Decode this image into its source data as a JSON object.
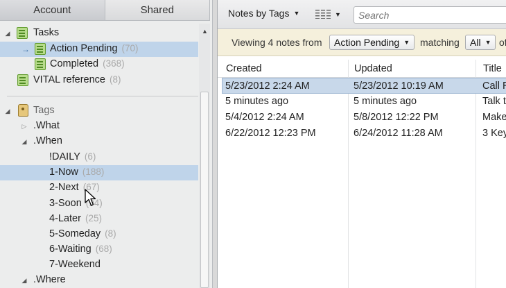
{
  "sidebar": {
    "tabs": [
      {
        "label": "Account"
      },
      {
        "label": "Shared"
      }
    ],
    "notebooks": {
      "group_label": "Tasks",
      "items": [
        {
          "label": "Action Pending",
          "count": "(70)"
        },
        {
          "label": "Completed",
          "count": "(368)"
        }
      ],
      "other": {
        "label": "VITAL reference",
        "count": "(8)"
      }
    },
    "tags": {
      "group_label": "Tags",
      "what": ".What",
      "when": ".When",
      "when_items": [
        {
          "label": "!DAILY",
          "count": "(6)"
        },
        {
          "label": "1-Now",
          "count": "(188)"
        },
        {
          "label": "2-Next",
          "count": "(67)"
        },
        {
          "label": "3-Soon",
          "count": "(94)"
        },
        {
          "label": "4-Later",
          "count": "(25)"
        },
        {
          "label": "5-Someday",
          "count": "(8)"
        },
        {
          "label": "6-Waiting",
          "count": "(68)"
        },
        {
          "label": "7-Weekend",
          "count": ""
        }
      ],
      "where": ".Where"
    }
  },
  "toolbar": {
    "view_label": "Notes by Tags",
    "search_placeholder": "Search"
  },
  "filter": {
    "prefix": "Viewing 4 notes from",
    "notebook": "Action Pending",
    "matching": "matching",
    "scope": "All",
    "suffix": "of"
  },
  "table": {
    "columns": [
      "Created",
      "Updated",
      "Title"
    ],
    "rows": [
      {
        "created": "5/23/2012 2:24 AM",
        "updated": "5/23/2012 10:19 AM",
        "title": "Call R"
      },
      {
        "created": "5 minutes ago",
        "updated": "5 minutes ago",
        "title": "Talk t"
      },
      {
        "created": "5/4/2012 2:24 AM",
        "updated": "5/8/2012 12:22 PM",
        "title": "Make"
      },
      {
        "created": "6/22/2012 12:23 PM",
        "updated": "6/24/2012 11:28 AM",
        "title": "3 Key"
      }
    ]
  },
  "colors": {
    "selection": "#bfd4ea",
    "filter_bar": "#f5f0dc",
    "notebook_green": "#b8dc8c"
  }
}
